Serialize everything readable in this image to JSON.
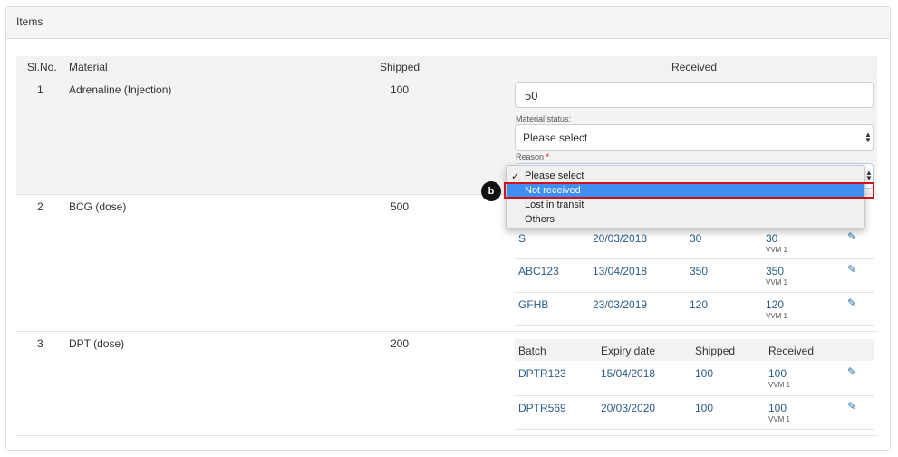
{
  "panel": {
    "title": "Items"
  },
  "table": {
    "headers": {
      "slno": "Sl.No.",
      "material": "Material",
      "shipped": "Shipped",
      "received": "Received"
    },
    "rows": [
      {
        "slno": "1",
        "material": "Adrenaline (Injection)",
        "shipped": "100"
      },
      {
        "slno": "2",
        "material": "BCG (dose)",
        "shipped": "500"
      },
      {
        "slno": "3",
        "material": "DPT (dose)",
        "shipped": "200"
      }
    ]
  },
  "received_form": {
    "quantity_value": "50",
    "material_status_label": "Material status:",
    "material_status_value": "Please select",
    "reason_label": "Reason",
    "reason_required": "*"
  },
  "reason_dropdown": {
    "checkmark": "✓",
    "options": [
      "Please select",
      "Not received",
      "Lost in transit",
      "Others"
    ],
    "selected": "Please select",
    "highlighted": "Not received"
  },
  "callout": {
    "label": "b"
  },
  "batches_bcg": [
    {
      "batch": "S",
      "expiry": "20/03/2018",
      "shipped": "30",
      "received": "30",
      "vvm": "VVM 1"
    },
    {
      "batch": "ABC123",
      "expiry": "13/04/2018",
      "shipped": "350",
      "received": "350",
      "vvm": "VVM 1"
    },
    {
      "batch": "GFHB",
      "expiry": "23/03/2019",
      "shipped": "120",
      "received": "120",
      "vvm": "VVM 1"
    }
  ],
  "batches_dpt_headers": {
    "batch": "Batch",
    "expiry": "Expiry date",
    "shipped": "Shipped",
    "received": "Received"
  },
  "batches_dpt": [
    {
      "batch": "DPTR123",
      "expiry": "15/04/2018",
      "shipped": "100",
      "received": "100",
      "vvm": "VVM 1"
    },
    {
      "batch": "DPTR569",
      "expiry": "20/03/2020",
      "shipped": "100",
      "received": "100",
      "vvm": "VVM 1"
    }
  ],
  "icons": {
    "edit": "edit-icon",
    "select_arrows": "updown-arrows-icon"
  },
  "colors": {
    "highlight": "#3e8ff0",
    "callout_border": "#d0101e",
    "link": "#2a5c8a"
  }
}
